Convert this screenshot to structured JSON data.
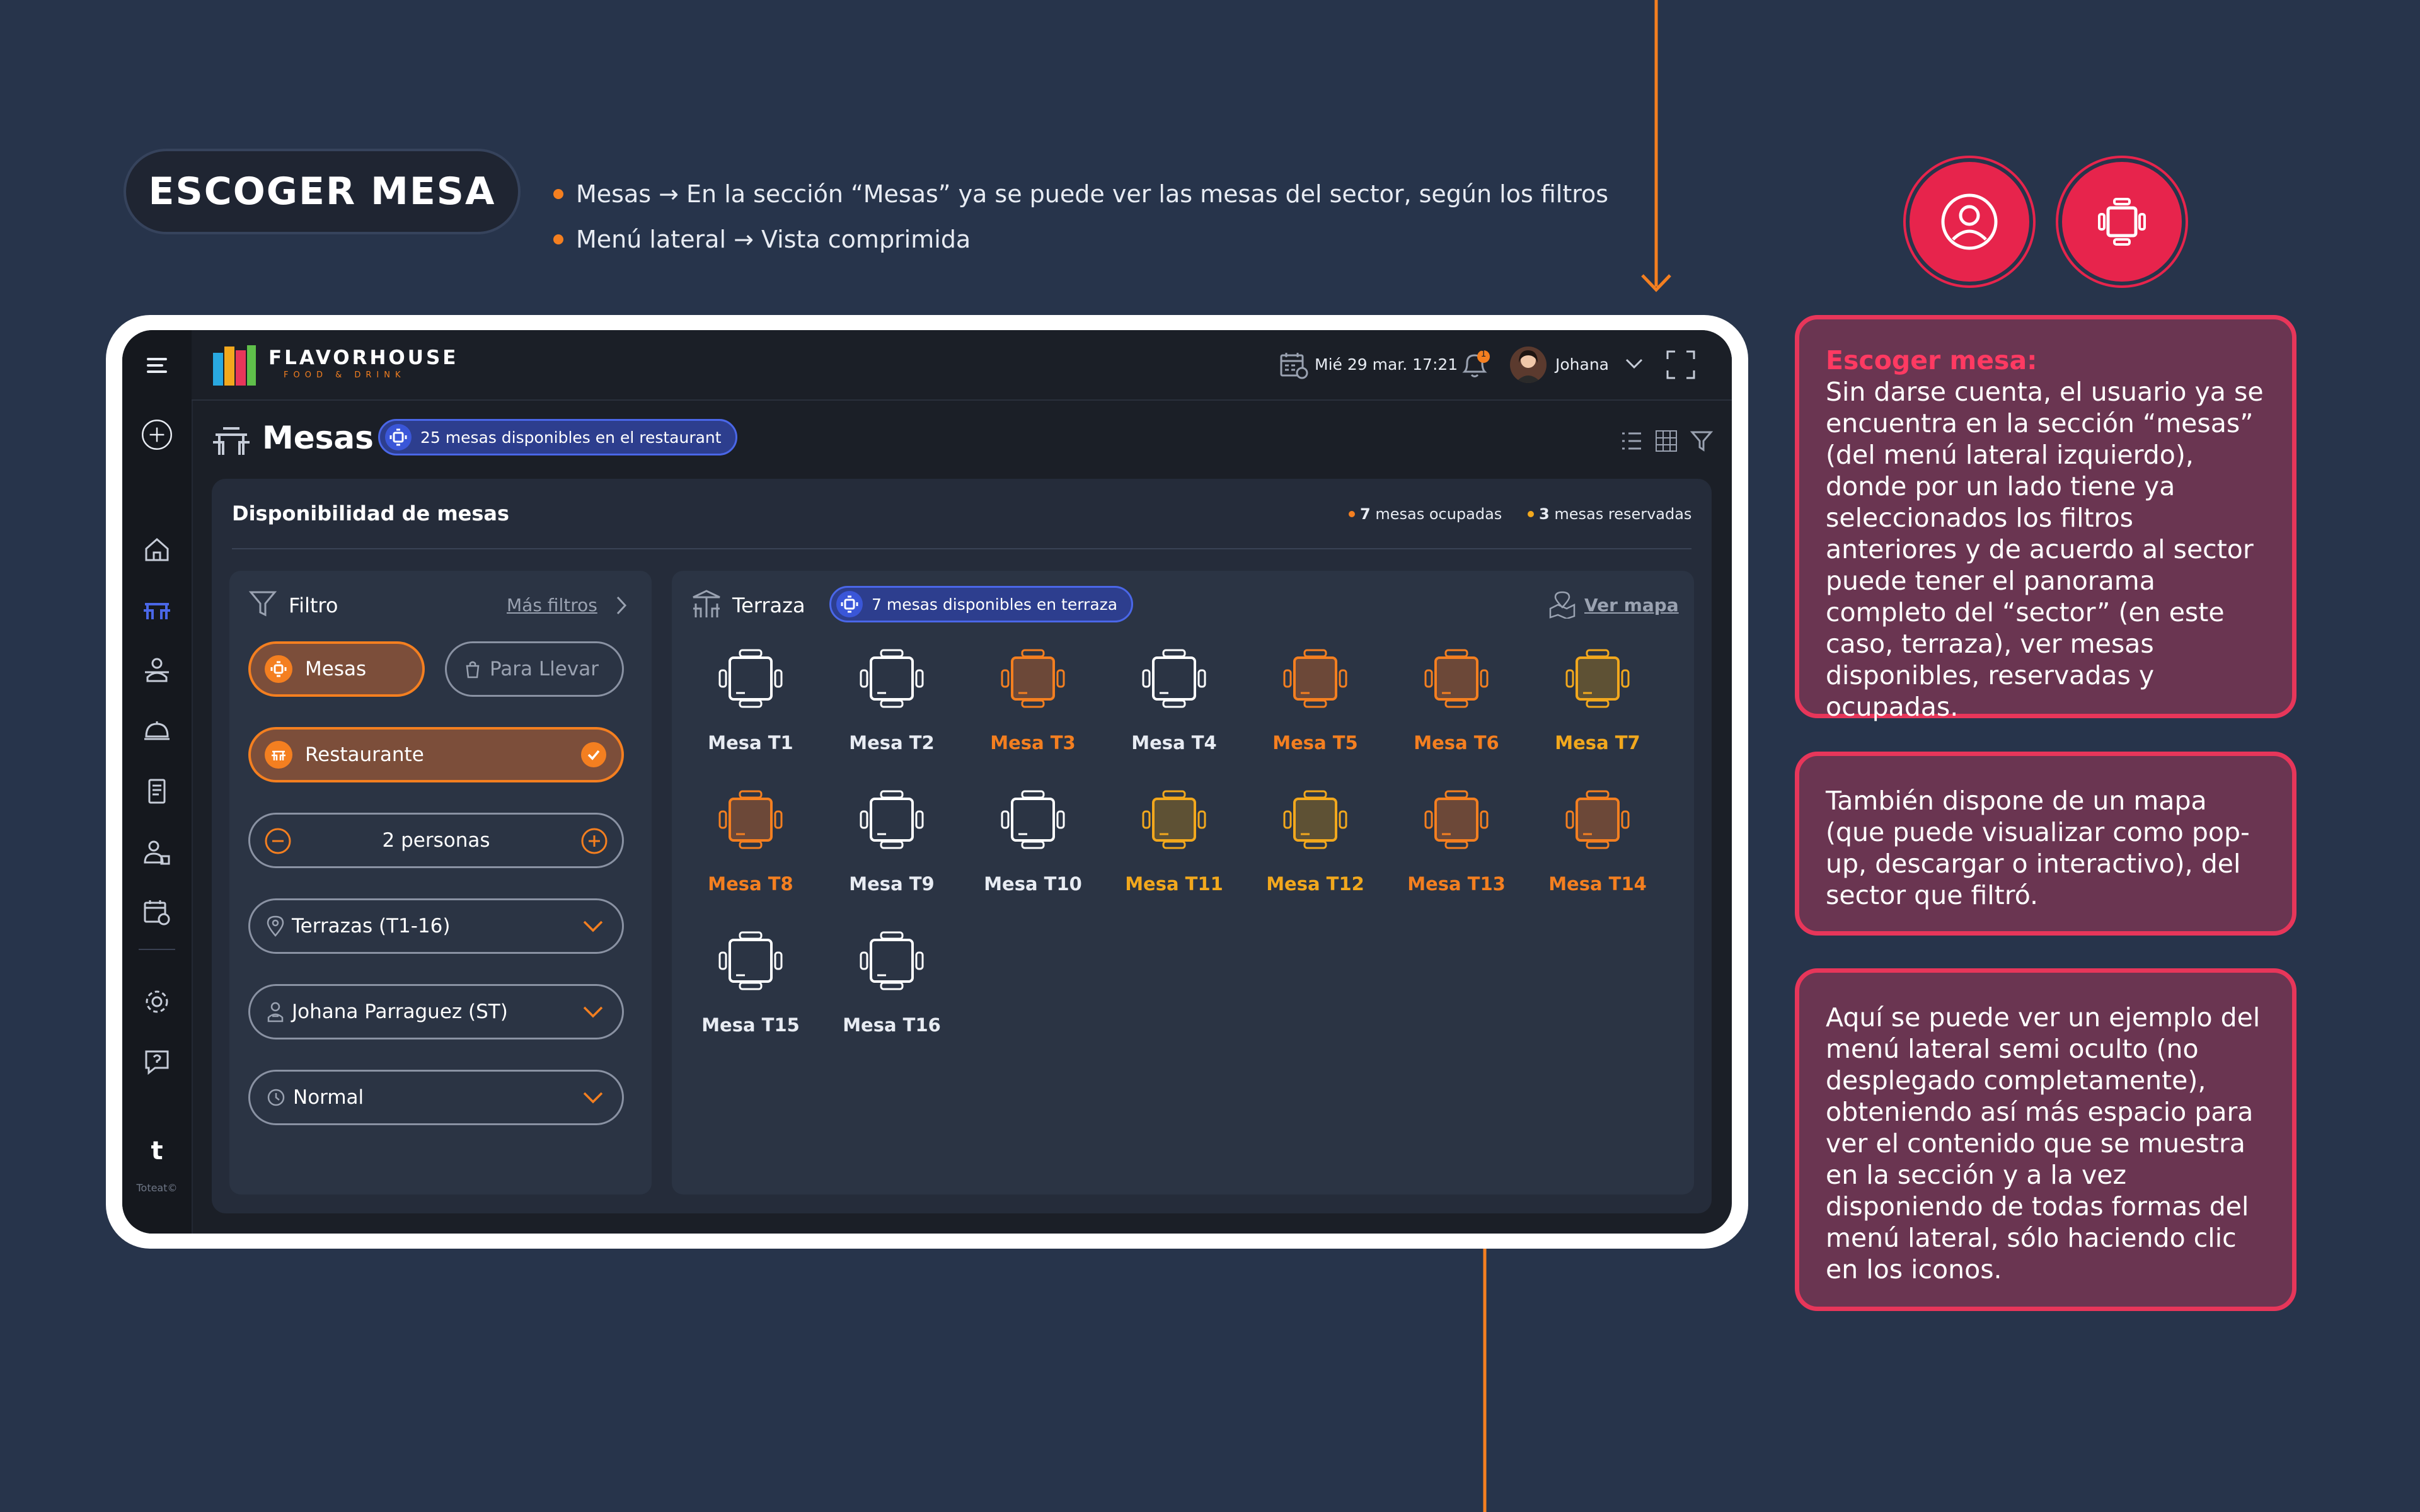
{
  "slide": {
    "title": "ESCOGER MESA",
    "bullets": [
      "Mesas → En la sección “Mesas” ya se puede ver las mesas del sector, según los filtros",
      "Menú lateral → Vista comprimida"
    ],
    "notes": [
      {
        "heading": "Escoger mesa:",
        "body": "Sin darse cuenta, el usuario ya se encuentra en la sección “mesas” (del menú lateral izquierdo), donde por un lado tiene ya seleccionados los filtros anteriores y de acuerdo al sector puede tener el panorama completo del “sector” (en este caso, terraza), ver mesas disponibles, reservadas y ocupadas."
      },
      {
        "heading": "",
        "body": "También dispone de un mapa (que puede visualizar como pop-up, descargar o interactivo), del sector que filtró."
      },
      {
        "heading": "",
        "body": "Aquí se puede ver un ejemplo del menú lateral semi oculto (no desplegado completamente), obteniendo así más espacio para ver el contenido que se muestra en la sección y a la vez disponiendo de todas formas del menú lateral, sólo haciendo clic en los iconos."
      }
    ],
    "colors": {
      "background": "#27344b",
      "accent": "#f47f20",
      "note_border": "#e7365a",
      "note_fill": "#6a3551",
      "circle": "#e7244c"
    }
  },
  "app": {
    "brand": {
      "name": "FLAVORHOUSE",
      "tagline": "FOOD & DRINK"
    },
    "header": {
      "datetime": "Mié 29 mar. 17:21",
      "notification_count": "1",
      "user_name": "Johana"
    },
    "sidebar": {
      "footer_logo": "t",
      "footer_label": "Toteat©"
    },
    "page": {
      "title": "Mesas",
      "availability_badge": "25 mesas disponibles en el restaurant"
    },
    "availability": {
      "title": "Disponibilidad de mesas",
      "occupied_count": "7",
      "occupied_label": "mesas ocupadas",
      "reserved_count": "3",
      "reserved_label": "mesas reservadas"
    },
    "filter": {
      "title": "Filtro",
      "more_filters": "Más filtros",
      "type_options": [
        "Mesas",
        "Para Llevar"
      ],
      "area": "Restaurante",
      "people": "2 personas",
      "zone": "Terrazas (T1-16)",
      "waiter": "Johana Parraguez (ST)",
      "mode": "Normal"
    },
    "sector": {
      "name": "Terraza",
      "availability_badge": "7 mesas disponibles en terraza",
      "map_link": "Ver mapa",
      "tables": [
        {
          "label": "Mesa T1",
          "status": "available"
        },
        {
          "label": "Mesa T2",
          "status": "available"
        },
        {
          "label": "Mesa T3",
          "status": "occupied"
        },
        {
          "label": "Mesa T4",
          "status": "available"
        },
        {
          "label": "Mesa T5",
          "status": "occupied"
        },
        {
          "label": "Mesa T6",
          "status": "occupied"
        },
        {
          "label": "Mesa T7",
          "status": "reserved"
        },
        {
          "label": "Mesa T8",
          "status": "occupied"
        },
        {
          "label": "Mesa T9",
          "status": "available"
        },
        {
          "label": "Mesa T10",
          "status": "available"
        },
        {
          "label": "Mesa T11",
          "status": "reserved"
        },
        {
          "label": "Mesa T12",
          "status": "reserved"
        },
        {
          "label": "Mesa T13",
          "status": "occupied"
        },
        {
          "label": "Mesa T14",
          "status": "occupied"
        },
        {
          "label": "Mesa T15",
          "status": "available"
        },
        {
          "label": "Mesa T16",
          "status": "available"
        }
      ]
    },
    "status_colors": {
      "available": "#ffffff",
      "occupied": "#f47f20",
      "reserved": "#f2a81d"
    }
  }
}
